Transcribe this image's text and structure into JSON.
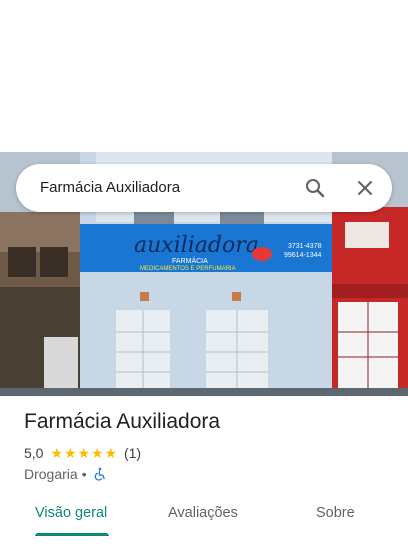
{
  "search": {
    "query": "Farmácia Auxiliadora"
  },
  "photo": {
    "sign_main": "auxiliadora",
    "sign_sub": "FARMÁCIA",
    "sign_tagline": "MEDICAMENTOS E PERFUMARIA",
    "phone_1": "3731-4378",
    "phone_2": "99614-1344",
    "colors": {
      "sign": "#1976d2",
      "wall": "#c9d9e8",
      "red_building": "#c62828"
    }
  },
  "place": {
    "title": "Farmácia Auxiliadora",
    "rating": "5,0",
    "stars": 5,
    "review_count": "(1)",
    "category": "Drogaria",
    "separator": "•",
    "accessibility_icon": "wheelchair-icon"
  },
  "tabs": [
    {
      "label": "Visão geral",
      "active": true
    },
    {
      "label": "Avaliações",
      "active": false
    },
    {
      "label": "Sobre",
      "active": false
    }
  ],
  "colors": {
    "accent": "#0b8a74",
    "star": "#fbbc04"
  }
}
